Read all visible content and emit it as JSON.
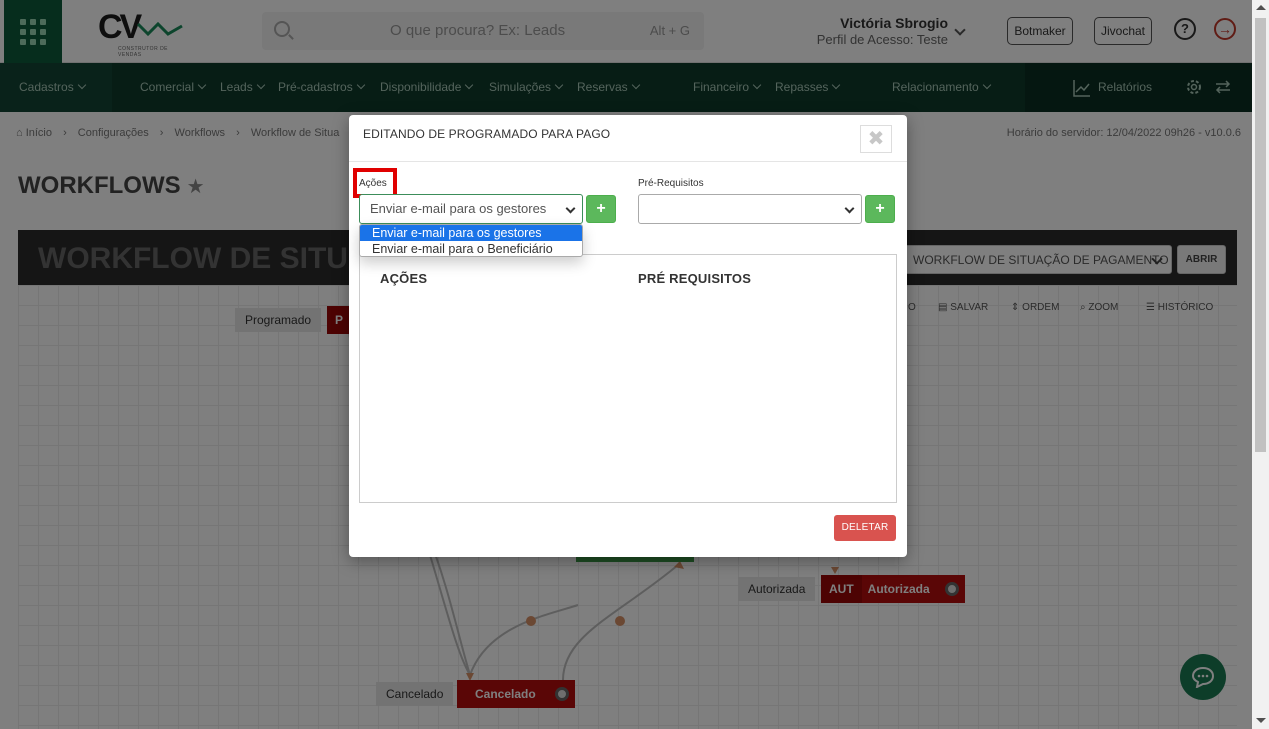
{
  "topbar": {
    "search_placeholder": "O que procura? Ex: Leads",
    "search_shortcut": "Alt + G",
    "user_name": "Victória Sbrogio",
    "user_profile": "Perfil de Acesso: Teste",
    "botmaker_label": "Botmaker",
    "jivochat_label": "Jivochat",
    "help_glyph": "?",
    "logo_text": "CV",
    "logo_sub": "CONSTRUTOR DE VENDAS"
  },
  "nav": {
    "items": [
      "Cadastros",
      "Comercial",
      "Leads",
      "Pré-cadastros",
      "Disponibilidade",
      "Simulações",
      "Reservas",
      "Financeiro",
      "Repasses",
      "Relacionamento",
      "Relatórios"
    ]
  },
  "breadcrumb": {
    "items": [
      "Início",
      "Configurações",
      "Workflows",
      "Workflow de Situa"
    ],
    "server_time": "Horário do servidor: 12/04/2022 09h26 - v10.0.6"
  },
  "page": {
    "title": "WORKFLOWS",
    "workflow_header": "WORKFLOW DE SITUA",
    "workflow_select": "WORKFLOW DE SITUAÇÃO DE PAGAMENTO",
    "abrir_label": "ABRIR",
    "toolbar": [
      "O",
      "SALVAR",
      "ORDEM",
      "ZOOM",
      "HISTÓRICO"
    ]
  },
  "nodes": {
    "programado_label": "Programado",
    "autorizada_label": "Autorizada",
    "autorizada_code": "AUT",
    "autorizada_name": "Autorizada",
    "cancelado_label": "Cancelado",
    "cancelado_name": "Cancelado",
    "programado_code_partial": "P"
  },
  "modal": {
    "title": "EDITANDO DE PROGRAMADO PARA PAGO",
    "close_glyph": "✖",
    "acoes_label": "Ações",
    "acoes_selected": "Enviar e-mail para os gestores",
    "acoes_options": [
      "Enviar e-mail para os gestores",
      "Enviar e-mail para o Beneficiário"
    ],
    "prereq_label": "Pré-Requisitos",
    "prereq_selected": "",
    "plus_glyph": "+",
    "panel_acoes_header": "AÇÕES",
    "panel_prereq_header": "PRÉ REQUISITOS",
    "deletar_label": "DELETAR"
  },
  "colors": {
    "nav_bg": "#0e3a2b",
    "brand_green": "#0d5a3a",
    "plus_green": "#5cb85c",
    "delete_red": "#d9534f",
    "node_red": "#b50d0d",
    "highlight_red": "#e00000",
    "selected_option": "#1a73e8"
  }
}
